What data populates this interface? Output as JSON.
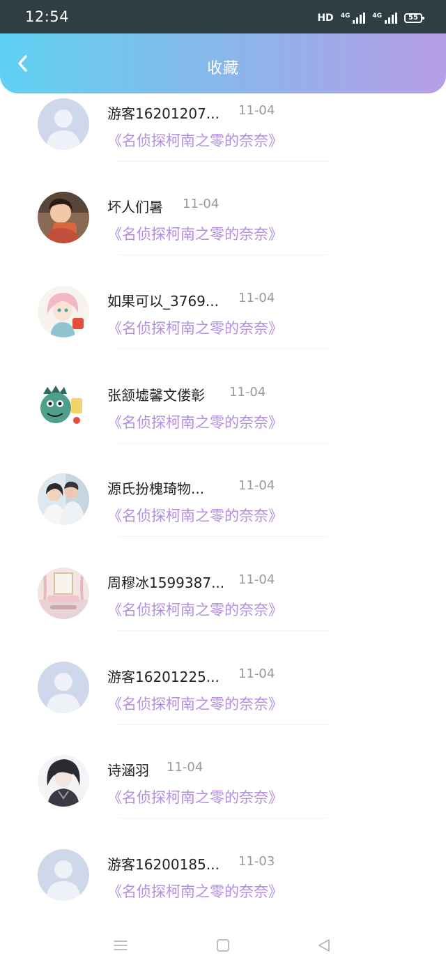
{
  "status_bar": {
    "time": "12:54",
    "network_hd": "HD",
    "signal_tag_1": "4G",
    "signal_tag_2": "4G",
    "battery": "55"
  },
  "header": {
    "title": "收藏",
    "back_icon": "chevron-left-icon"
  },
  "colors": {
    "header_gradient_start": "#5fd1f2",
    "header_gradient_end": "#b89ee6",
    "book_title": "#b48ee0",
    "status_bar_bg": "#2f3d44"
  },
  "items": [
    {
      "name": "游客16201207...",
      "date": "11-04",
      "book": "《名侦探柯南之零的奈奈》",
      "avatar": "default-avatar"
    },
    {
      "name": "坏人们暑",
      "date": "11-04",
      "book": "《名侦探柯南之零的奈奈》",
      "avatar": "photo-avatar"
    },
    {
      "name": "如果可以_3769...",
      "date": "11-04",
      "book": "《名侦探柯南之零的奈奈》",
      "avatar": "anime-avatar"
    },
    {
      "name": "张颔墟馨文偻彰",
      "date": "11-04",
      "book": "《名侦探柯南之零的奈奈》",
      "avatar": "dinosaur-avatar"
    },
    {
      "name": "源氏扮槐琦物...",
      "date": "11-04",
      "book": "《名侦探柯南之零的奈奈》",
      "avatar": "couple-photo-avatar"
    },
    {
      "name": "周穆冰1599387...",
      "date": "11-04",
      "book": "《名侦探柯南之零的奈奈》",
      "avatar": "room-photo-avatar"
    },
    {
      "name": "游客16201225...",
      "date": "11-04",
      "book": "《名侦探柯南之零的奈奈》",
      "avatar": "default-avatar"
    },
    {
      "name": "诗涵羽",
      "date": "11-04",
      "book": "《名侦探柯南之零的奈奈》",
      "avatar": "dark-anime-avatar"
    },
    {
      "name": "游客16200185...",
      "date": "11-03",
      "book": "《名侦探柯南之零的奈奈》",
      "avatar": "default-avatar"
    }
  ],
  "nav_bar": {
    "icons": [
      "menu-icon",
      "home-square-icon",
      "back-triangle-icon"
    ]
  }
}
